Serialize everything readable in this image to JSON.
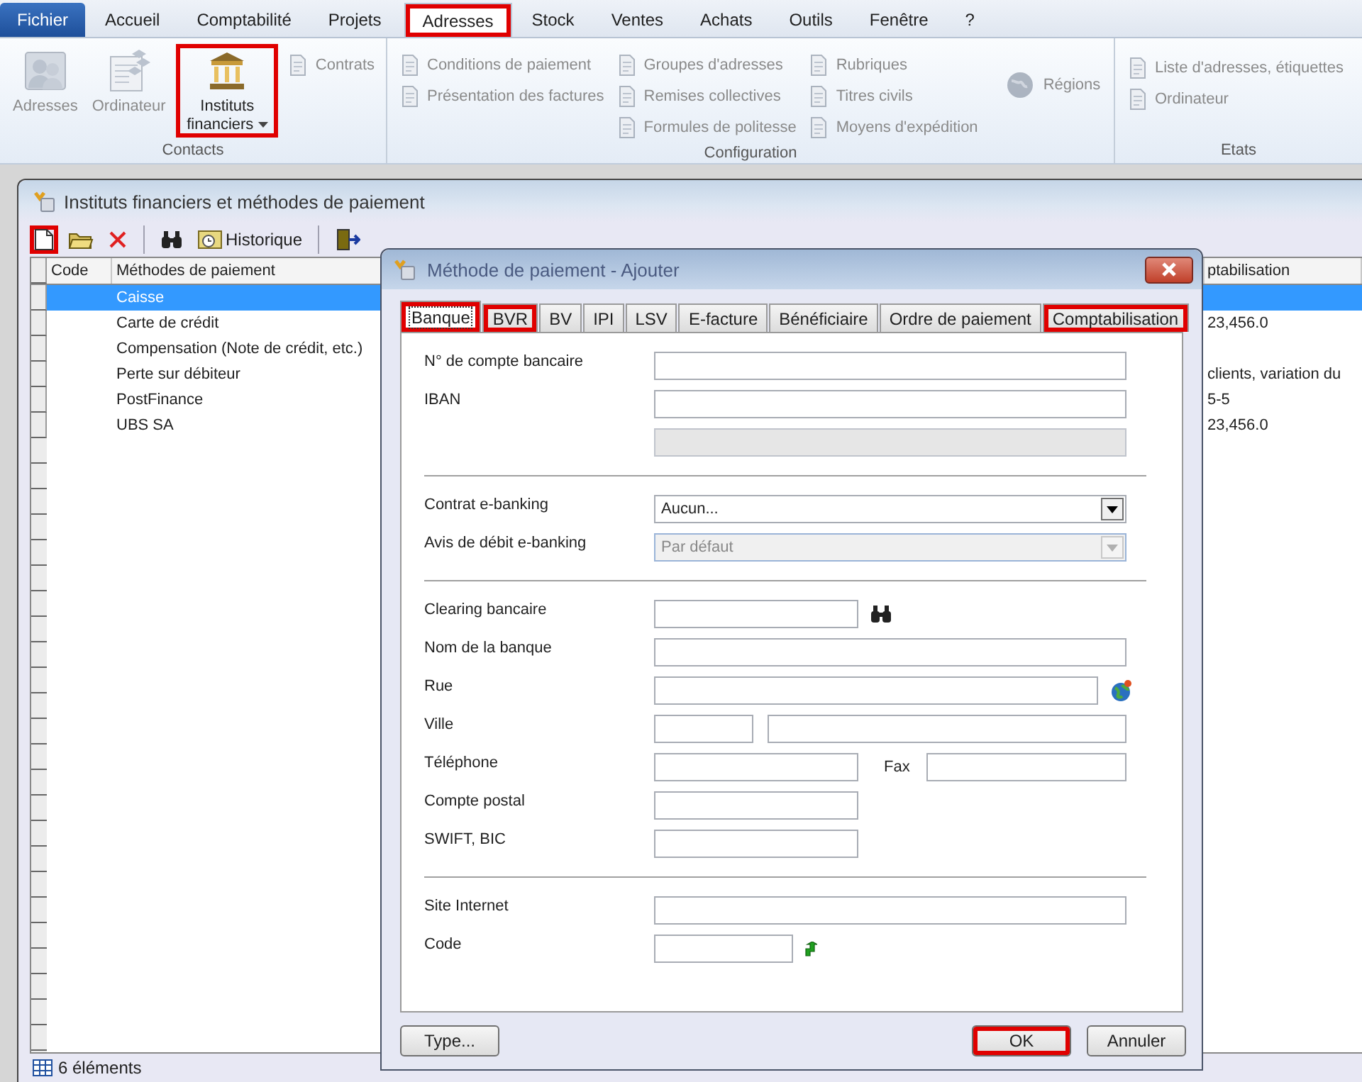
{
  "menu_tabs": [
    {
      "label": "Fichier",
      "kind": "file",
      "selected": false,
      "highlighted": false
    },
    {
      "label": "Accueil",
      "kind": "tab",
      "selected": false,
      "highlighted": false
    },
    {
      "label": "Comptabilité",
      "kind": "tab",
      "selected": false,
      "highlighted": false
    },
    {
      "label": "Projets",
      "kind": "tab",
      "selected": false,
      "highlighted": false
    },
    {
      "label": "Adresses",
      "kind": "tab",
      "selected": true,
      "highlighted": true
    },
    {
      "label": "Stock",
      "kind": "tab",
      "selected": false,
      "highlighted": false
    },
    {
      "label": "Ventes",
      "kind": "tab",
      "selected": false,
      "highlighted": false
    },
    {
      "label": "Achats",
      "kind": "tab",
      "selected": false,
      "highlighted": false
    },
    {
      "label": "Outils",
      "kind": "tab",
      "selected": false,
      "highlighted": false
    },
    {
      "label": "Fenêtre",
      "kind": "tab",
      "selected": false,
      "highlighted": false
    },
    {
      "label": "?",
      "kind": "tab",
      "selected": false,
      "highlighted": false
    }
  ],
  "ribbon": {
    "groups": [
      {
        "label": "Contacts",
        "columns": [
          [
            {
              "kind": "large",
              "label": "Adresses",
              "disabled": true,
              "highlighted": false
            }
          ],
          [
            {
              "kind": "large",
              "label": "Ordinateur",
              "disabled": true,
              "highlighted": false
            }
          ],
          [
            {
              "kind": "large",
              "label": "Instituts financiers",
              "disabled": false,
              "highlighted": true,
              "dropdown": true
            }
          ],
          [
            {
              "kind": "small",
              "label": "Contrats",
              "disabled": true,
              "highlighted": false
            }
          ]
        ]
      },
      {
        "label": "Configuration",
        "columns": [
          [
            {
              "kind": "small",
              "label": "Conditions de paiement",
              "disabled": true,
              "highlighted": false
            },
            {
              "kind": "small",
              "label": "Présentation des factures",
              "disabled": true,
              "highlighted": false
            }
          ],
          [
            {
              "kind": "small",
              "label": "Groupes d'adresses",
              "disabled": true,
              "highlighted": false
            },
            {
              "kind": "small",
              "label": "Remises collectives",
              "disabled": true,
              "highlighted": false
            },
            {
              "kind": "small",
              "label": "Formules de politesse",
              "disabled": true,
              "highlighted": false
            }
          ],
          [
            {
              "kind": "small",
              "label": "Rubriques",
              "disabled": true,
              "highlighted": false
            },
            {
              "kind": "small",
              "label": "Titres civils",
              "disabled": true,
              "highlighted": false
            },
            {
              "kind": "small",
              "label": "Moyens d'expédition",
              "disabled": true,
              "highlighted": false
            }
          ],
          [
            {
              "kind": "globe",
              "label": "Régions",
              "disabled": true,
              "highlighted": false
            }
          ]
        ]
      },
      {
        "label": "Etats",
        "columns": [
          [
            {
              "kind": "small",
              "label": "Liste d'adresses, étiquettes",
              "disabled": true,
              "highlighted": false
            },
            {
              "kind": "small",
              "label": "Ordinateur",
              "disabled": true,
              "highlighted": false
            }
          ]
        ]
      }
    ]
  },
  "window": {
    "title": "Instituts financiers et méthodes de paiement",
    "toolbar": [
      {
        "kind": "new",
        "highlighted": true
      },
      {
        "kind": "open",
        "highlighted": false
      },
      {
        "kind": "delete",
        "highlighted": false
      },
      {
        "kind": "separator"
      },
      {
        "kind": "find",
        "highlighted": false
      },
      {
        "kind": "history",
        "label": "Historique",
        "highlighted": false
      },
      {
        "kind": "separator"
      },
      {
        "kind": "exit",
        "highlighted": false
      }
    ],
    "table": {
      "columns": [
        "Code",
        "Méthodes de paiement",
        "ptabilisation"
      ],
      "rows": [
        {
          "method": "Caisse",
          "selected": true
        },
        {
          "method": "Carte de crédit",
          "column_3": "23,456.0",
          "selected": false
        },
        {
          "method": "Compensation (Note de crédit, etc.)",
          "selected": false
        },
        {
          "method": "Perte sur débiteur",
          "column_3": "clients, variation du",
          "selected": false
        },
        {
          "method": "PostFinance",
          "column_3": "5-5",
          "selected": false
        },
        {
          "method": "UBS SA",
          "column_3": "23,456.0",
          "selected": false
        }
      ]
    },
    "status_bar": "6 éléments"
  },
  "dialog": {
    "title": "Méthode de paiement - Ajouter",
    "tabs": [
      {
        "label": "Banque",
        "selected": true,
        "highlighted": true
      },
      {
        "label": "BVR",
        "selected": false,
        "highlighted": true
      },
      {
        "label": "BV",
        "selected": false,
        "highlighted": false
      },
      {
        "label": "IPI",
        "selected": false,
        "highlighted": false
      },
      {
        "label": "LSV",
        "selected": false,
        "highlighted": false
      },
      {
        "label": "E-facture",
        "selected": false,
        "highlighted": false
      },
      {
        "label": "Bénéficiaire",
        "selected": false,
        "highlighted": false
      },
      {
        "label": "Ordre de paiement",
        "selected": false,
        "highlighted": false
      },
      {
        "label": "Comptabilisation",
        "selected": false,
        "highlighted": true
      }
    ],
    "sections": [
      [
        {
          "kind": "wide",
          "label": "N° de compte bancaire",
          "disabled": false
        },
        {
          "kind": "wide",
          "label": "IBAN",
          "disabled": false
        },
        {
          "kind": "wide",
          "disabled": true
        }
      ],
      [
        {
          "kind": "select",
          "label": "Contrat e-banking",
          "value": "Aucun...",
          "disabled": false
        },
        {
          "kind": "select",
          "label": "Avis de débit e-banking",
          "value": "Par défaut",
          "disabled": true
        }
      ],
      [
        {
          "kind": "search",
          "label": "Clearing bancaire",
          "disabled": false
        },
        {
          "kind": "wide",
          "label": "Nom de la banque",
          "disabled": false
        },
        {
          "kind": "street",
          "label": "Rue",
          "disabled": false
        },
        {
          "kind": "city",
          "label": "Ville",
          "disabled": false
        },
        {
          "kind": "phone",
          "label": "Téléphone",
          "second_label": "Fax",
          "disabled": false
        },
        {
          "kind": "medium",
          "label": "Compte postal",
          "disabled": false
        },
        {
          "kind": "medium",
          "label": "SWIFT, BIC",
          "disabled": false
        }
      ],
      [
        {
          "kind": "wide",
          "label": "Site Internet",
          "disabled": false
        },
        {
          "kind": "code",
          "label": "Code",
          "disabled": false
        }
      ]
    ],
    "buttons": [
      {
        "label": "Type...",
        "kind": "left",
        "highlighted": false
      },
      {
        "label": "OK",
        "kind": "right",
        "highlighted": true
      },
      {
        "label": "Annuler",
        "kind": "right",
        "highlighted": false
      }
    ]
  }
}
